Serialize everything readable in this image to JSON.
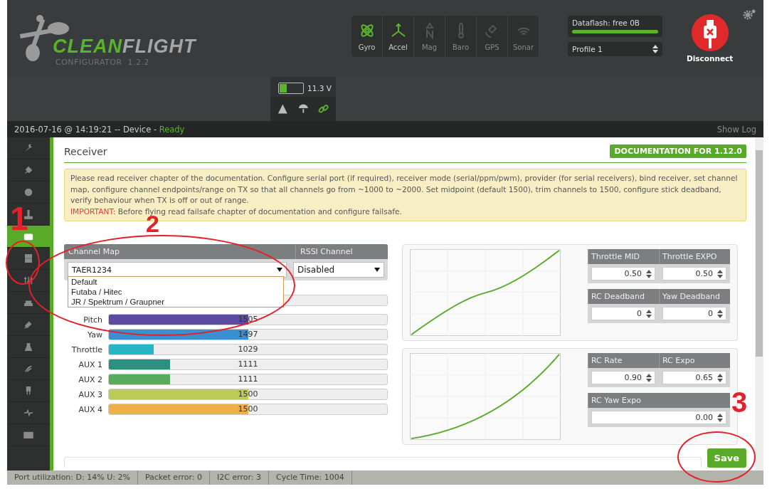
{
  "logo": {
    "brand_green": "CLEAN",
    "brand_grey": "FLIGHT",
    "subtitle": "CONFIGURATOR  1.2.2"
  },
  "sensors": [
    {
      "label": "Gyro",
      "active": true
    },
    {
      "label": "Accel",
      "active": true
    },
    {
      "label": "Mag",
      "active": false
    },
    {
      "label": "Baro",
      "active": false
    },
    {
      "label": "GPS",
      "active": false
    },
    {
      "label": "Sonar",
      "active": false
    }
  ],
  "dataflash": {
    "label": "Dataflash: free 0B",
    "level": 1
  },
  "profile": "Profile 1",
  "disconnect": "Disconnect",
  "battery": {
    "level": 0.3,
    "voltage": "11.3 V"
  },
  "status_icons": [
    {
      "on": false
    },
    {
      "on": false
    },
    {
      "on": true
    }
  ],
  "log": {
    "timestamp": "2016-07-16 @ 14:19:21 -- Device - ",
    "state": "Ready",
    "show_log": "Show Log"
  },
  "sidebar": {
    "items": [
      {
        "selected": false
      },
      {
        "selected": false
      },
      {
        "selected": false
      },
      {
        "selected": false
      },
      {
        "selected": true
      },
      {
        "selected": false
      },
      {
        "selected": false
      },
      {
        "selected": false
      },
      {
        "selected": false
      },
      {
        "selected": false
      },
      {
        "selected": false
      },
      {
        "selected": false
      },
      {
        "selected": false
      },
      {
        "selected": false
      }
    ]
  },
  "receiver": {
    "title": "Receiver",
    "doc_button": "DOCUMENTATION FOR 1.12.0",
    "note": "Please read receiver chapter of the documentation. Configure serial port (if required), receiver mode (serial/ppm/pwm), provider (for serial receivers), bind receiver, set channel map, configure channel endpoints/range on TX so that all channels go from ~1000 to ~2000. Set midpoint (default 1500), trim channels to 1500, configure stick deadband, verify behaviour when TX is off or out of range.",
    "important_label": "IMPORTANT:",
    "important_text": "Before flying read failsafe chapter of documentation and configure failsafe."
  },
  "channel_map": {
    "header": "Channel Map",
    "value": "TAER1234",
    "expanded": true,
    "options": [
      "Default",
      "Futaba / Hitec",
      "JR / Spektrum / Graupner"
    ]
  },
  "rssi": {
    "header": "RSSI Channel",
    "value": "Disabled"
  },
  "channels": [
    {
      "name": "Pitch",
      "value": "1505",
      "level": 0.5,
      "color": "#5c4a9e"
    },
    {
      "name": "Yaw",
      "value": "1497",
      "level": 0.5,
      "color": "#3a8fd0"
    },
    {
      "name": "Throttle",
      "value": "1029",
      "level": 0.16,
      "color": "#27b5c8"
    },
    {
      "name": "AUX 1",
      "value": "1111",
      "level": 0.22,
      "color": "#2e9080"
    },
    {
      "name": "AUX 2",
      "value": "1111",
      "level": 0.22,
      "color": "#58aa5c"
    },
    {
      "name": "AUX 3",
      "value": "1500",
      "level": 0.5,
      "color": "#bccb58"
    },
    {
      "name": "AUX 4",
      "value": "1500",
      "level": 0.5,
      "color": "#f0b048"
    }
  ],
  "curve_panels": [
    {
      "fields": [
        {
          "label": "Throttle MID",
          "value": "0.50"
        },
        {
          "label": "Throttle EXPO",
          "value": "0.50"
        },
        {
          "label": "RC Deadband",
          "value": "0"
        },
        {
          "label": "Yaw Deadband",
          "value": "0"
        }
      ]
    },
    {
      "fields": [
        {
          "label": "RC Rate",
          "value": "0.90"
        },
        {
          "label": "RC Expo",
          "value": "0.65"
        },
        {
          "label": "RC Yaw Expo",
          "value": "0.00"
        }
      ]
    }
  ],
  "save_button": "Save",
  "status_bar": [
    "Port utilization: D: 14% U: 2%",
    "Packet error: 0",
    "I2C error: 3",
    "Cycle Time: 1004"
  ],
  "annotations": [
    {
      "label": "1"
    },
    {
      "label": "2"
    },
    {
      "label": "3"
    }
  ]
}
